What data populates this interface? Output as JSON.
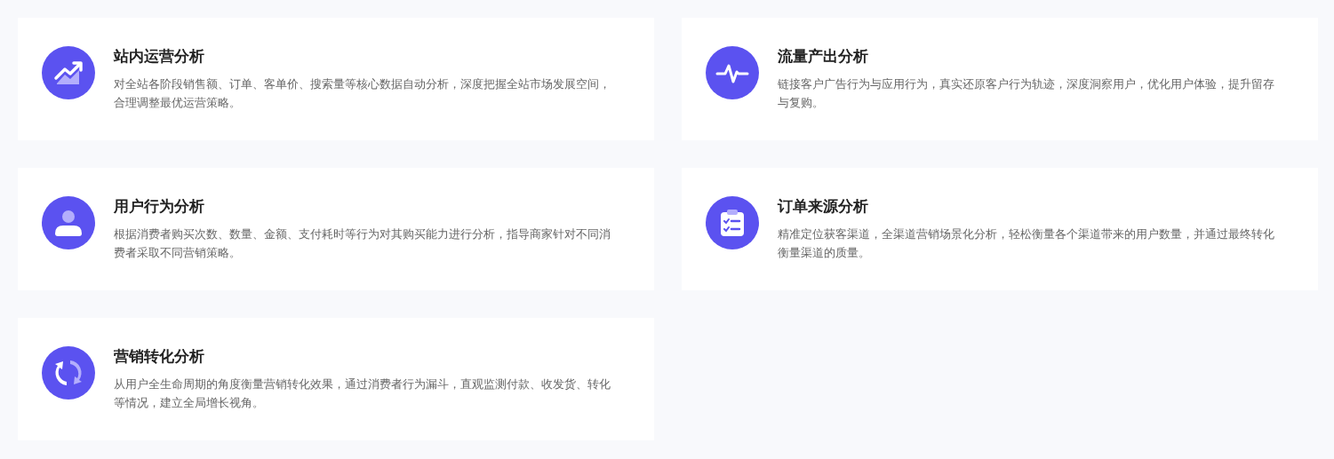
{
  "features": [
    {
      "kind": "trend",
      "title": "站内运营分析",
      "description": "对全站各阶段销售额、订单、客单价、搜索量等核心数据自动分析，深度把握全站市场发展空间，合理调整最优运营策略。"
    },
    {
      "kind": "pulse",
      "title": "流量产出分析",
      "description": "链接客户广告行为与应用行为，真实还原客户行为轨迹，深度洞察用户，优化用户体验，提升留存与复购。"
    },
    {
      "kind": "user",
      "title": "用户行为分析",
      "description": "根据消费者购买次数、数量、金额、支付耗时等行为对其购买能力进行分析，指导商家针对不同消费者采取不同营销策略。"
    },
    {
      "kind": "checklist",
      "title": "订单来源分析",
      "description": "精准定位获客渠道，全渠道营销场景化分析，轻松衡量各个渠道带来的用户数量，并通过最终转化衡量渠道的质量。"
    },
    {
      "kind": "refresh",
      "title": "营销转化分析",
      "description": "从用户全生命周期的角度衡量营销转化效果，通过消费者行为漏斗，直观监测付款、收发货、转化等情况，建立全局增长视角。"
    }
  ]
}
